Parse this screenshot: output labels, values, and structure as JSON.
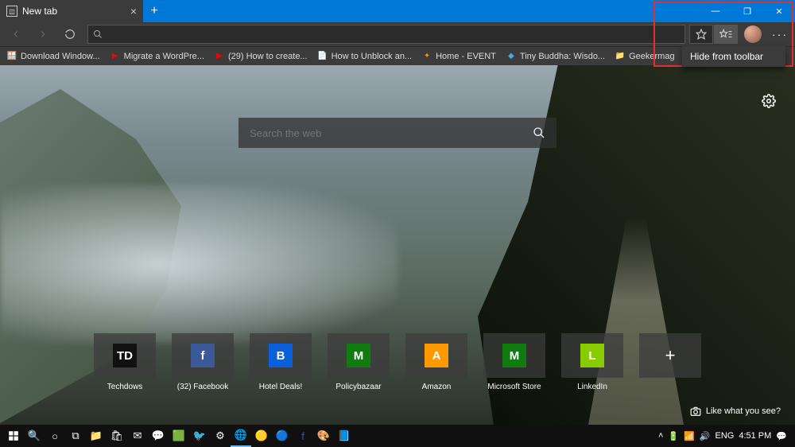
{
  "tab": {
    "title": "New tab"
  },
  "bookmarks": [
    {
      "label": "Download Window...",
      "icon": "🪟",
      "color": "#0078d7"
    },
    {
      "label": "Migrate a WordPre...",
      "icon": "▶",
      "color": "#ff0000"
    },
    {
      "label": "(29) How to create...",
      "icon": "▶",
      "color": "#ff0000"
    },
    {
      "label": "How to Unblock an...",
      "icon": "📄",
      "color": "#ffffff"
    },
    {
      "label": "Home - EVENT",
      "icon": "✦",
      "color": "#ff8800"
    },
    {
      "label": "Tiny Buddha: Wisdo...",
      "icon": "◆",
      "color": "#44aadd"
    },
    {
      "label": "Geekermag",
      "icon": "📁",
      "color": "#ffcc44"
    }
  ],
  "search": {
    "placeholder": "Search the web"
  },
  "tiles": [
    {
      "label": "Techdows",
      "badge": "TD",
      "bg": "#111111"
    },
    {
      "label": "(32) Facebook",
      "badge": "f",
      "bg": "#3b5998"
    },
    {
      "label": "Hotel Deals!",
      "badge": "B",
      "bg": "#0a5fdb"
    },
    {
      "label": "Policybazaar",
      "badge": "M",
      "bg": "#107c10"
    },
    {
      "label": "Amazon",
      "badge": "A",
      "bg": "#ff9900"
    },
    {
      "label": "Microsoft Store",
      "badge": "M",
      "bg": "#107c10"
    },
    {
      "label": "LinkedIn",
      "badge": "L",
      "bg": "#88cc00"
    }
  ],
  "context_menu": {
    "item": "Hide from toolbar"
  },
  "like_text": "Like what you see?",
  "tray": {
    "lang": "ENG",
    "time": "4:51 PM"
  }
}
